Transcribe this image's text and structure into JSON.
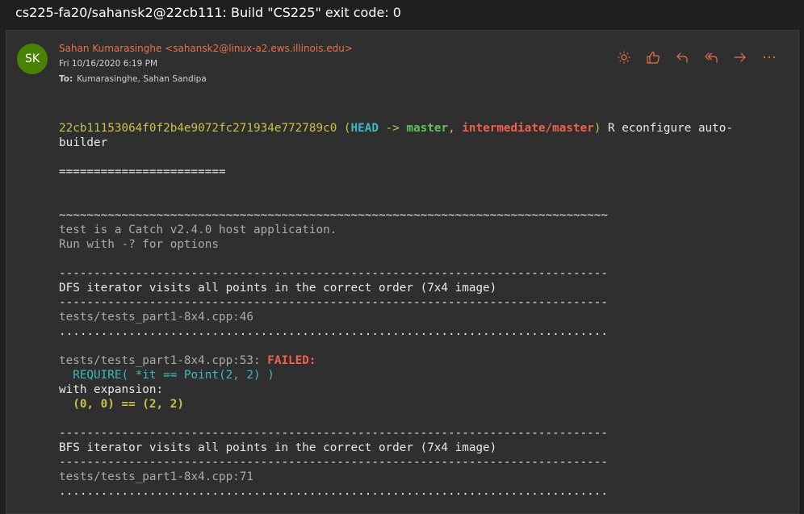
{
  "window": {
    "title": "cs225-fa20/sahansk2@22cb111: Build \"CS225\" exit code: 0"
  },
  "message": {
    "avatar_initials": "SK",
    "sender": "Sahan Kumarasinghe <sahansk2@linux-a2.ews.illinois.edu>",
    "date": "Fri 10/16/2020 6:19 PM",
    "to_label": "To:",
    "to": "Kumarasinghe, Sahan Sandipa",
    "colors": {
      "avatar_bg": "#498205",
      "accent": "#e8734a"
    }
  },
  "actions": [
    {
      "name": "brightness-icon"
    },
    {
      "name": "like-icon"
    },
    {
      "name": "reply-icon"
    },
    {
      "name": "reply-all-icon"
    },
    {
      "name": "forward-icon"
    },
    {
      "name": "more-icon"
    }
  ],
  "body": {
    "commit": {
      "hash": "22cb11153064f0f2b4e9072fc271934e772789c0",
      "open": " (",
      "head": "HEAD",
      "arrow": " -> ",
      "master": "master",
      "comma": ", ",
      "inter": "intermediate/master",
      "close": ")",
      "msg1": " R econfigure auto-",
      "msg2": "builder"
    },
    "separator": "========================",
    "tilde_line": "~~~~~~~~~~~~~~~~~~~~~~~~~~~~~~~~~~~~~~~~~~~~~~~~~~~~~~~~~~~~~~~~~~~~~~~~~~~~~~~",
    "catch_line1": "test is a Catch v2.4.0 host application.",
    "catch_line2": "Run with -? for options",
    "dash_line": "-------------------------------------------------------------------------------",
    "dot_line": "...............................................................................",
    "test1": {
      "title": "DFS iterator visits all points in the correct order (7x4 image)",
      "location": "tests/tests_part1-8x4.cpp:46",
      "fail_loc": "tests/tests_part1-8x4.cpp:53: ",
      "fail_word": "FAILED:",
      "require": "  REQUIRE( *it == Point(2, 2) )",
      "with_expansion": "with expansion:",
      "expansion": "  (0, 0) == (2, 2)"
    },
    "test2": {
      "title": "BFS iterator visits all points in the correct order (7x4 image)",
      "location": "tests/tests_part1-8x4.cpp:71"
    }
  }
}
